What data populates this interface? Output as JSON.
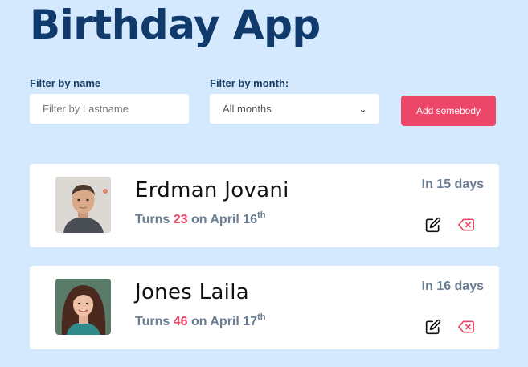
{
  "app": {
    "title": "Birthday App"
  },
  "filters": {
    "name_label": "Filter by name",
    "name_placeholder": "Filter by Lastname",
    "name_value": "",
    "month_label": "Filter by month:",
    "month_selected": "All months",
    "add_label": "Add somebody"
  },
  "people": [
    {
      "name": "Erdman Jovani",
      "turns_prefix": "Turns",
      "age": "23",
      "date_text": "on April 16",
      "suffix": "th",
      "days_left": "In 15 days"
    },
    {
      "name": "Jones Laila",
      "turns_prefix": "Turns",
      "age": "46",
      "date_text": "on April 17",
      "suffix": "th",
      "days_left": "In 16 days"
    }
  ],
  "icons": {
    "edit": "edit-icon",
    "delete": "backspace-delete-icon",
    "dropdown": "chevron-down-icon"
  },
  "colors": {
    "background": "#d4e9fd",
    "title": "#0f3a6b",
    "accent": "#ec4768",
    "muted": "#6a7d93"
  }
}
